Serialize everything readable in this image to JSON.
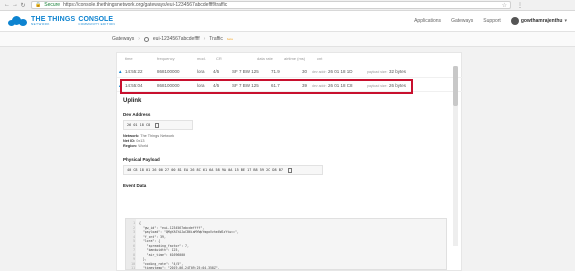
{
  "browser": {
    "secure_label": "Secure",
    "url": "https://console.thethingsnetwork.org/gateways/eui-1234567abcdeffff/traffic"
  },
  "header": {
    "logo_main": "THE THINGS",
    "logo_sub": "NETWORK",
    "console_main": "CONSOLE",
    "console_sub": "COMMUNITY EDITION",
    "nav": [
      "Applications",
      "Gateways",
      "Support"
    ],
    "username": "gowthamrajenthu"
  },
  "breadcrumb": {
    "gateways": "Gateways",
    "gateway_id": "eui-1234567abcdeffff",
    "traffic": "Traffic",
    "badge": "beta"
  },
  "table": {
    "columns": [
      "time",
      "frequency",
      "mod.",
      "CR",
      "data rate",
      "airtime (ms)",
      "cnt"
    ],
    "rows": [
      {
        "time": "14:55:22",
        "frequency": "868100000",
        "mod": "lora",
        "cr": "4/5",
        "datarate": "SF 7 BW 125",
        "airtime": "71.9",
        "cnt": "30",
        "dev_label": "dev addr:",
        "dev_addr": "26 01 18 1D",
        "payload_label": "payload size:",
        "payload": "32 bytes"
      },
      {
        "time": "14:55:04",
        "frequency": "868100000",
        "mod": "lora",
        "cr": "4/5",
        "datarate": "SF 7 BW 125",
        "airtime": "61.7",
        "cnt": "39",
        "dev_label": "dev addr:",
        "dev_addr": "26 01 18 C8",
        "payload_label": "payload size:",
        "payload": "26 bytes"
      }
    ]
  },
  "detail": {
    "title": "Uplink",
    "dev_address_label": "Dev Address",
    "dev_address": "26 01 18 C8",
    "network_label": "Network:",
    "network": "The Things Network",
    "net_id_label": "Net ID:",
    "net_id": "0x13",
    "region_label": "Region:",
    "region": "World",
    "physical_payload_label": "Physical Payload",
    "physical_payload": "40 C8 18 01 26 00 27 00 81 EA 26 8C 61 6A 58 9A 0A 15 BE 17 B8 59 2C D8 B7",
    "event_data_label": "Event Data"
  },
  "event_lines": [
    "{",
    "  \"gw_id\": \"eui-1234567abcdeffff\",",
    "  \"payload\": \"QMgYASYAJwCB6iaMYWpYmgoVvhe4WSzYtw==\",",
    "  \"f_cnt\": 39,",
    "  \"lora\": {",
    "    \"spreading_factor\": 7,",
    "    \"bandwidth\": 125,",
    "    \"air_time\": 61696000",
    "  },",
    "  \"coding_rate\": \"4/5\",",
    "  \"timestamp\": \"2019-06-24T09:25:04.358Z\",",
    "  \"rssi\": -49,"
  ],
  "line_numbers": [
    "1",
    "2",
    "3",
    "4",
    "5",
    "6",
    "7",
    "8",
    "9",
    "10",
    "11",
    "12"
  ]
}
